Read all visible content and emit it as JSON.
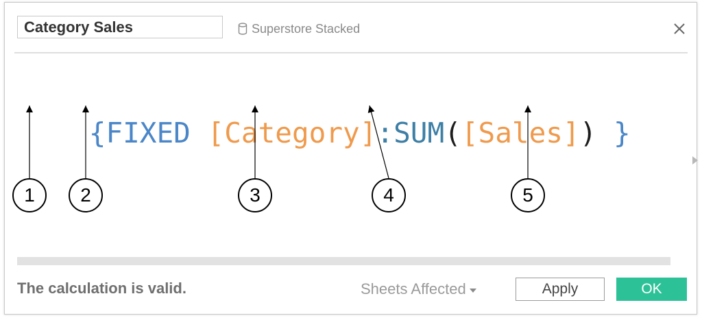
{
  "dialog": {
    "calc_name": "Category Sales",
    "data_source": "Superstore Stacked",
    "data_source_icon": "database-icon",
    "close_icon": "close-icon"
  },
  "formula": {
    "tokens": [
      {
        "text": "{",
        "color": "#4a86c8"
      },
      {
        "text": "FIXED",
        "color": "#4a86c8"
      },
      {
        "text": " ",
        "color": "#4a86c8"
      },
      {
        "text": "[Category]",
        "color": "#ef9a4c"
      },
      {
        "text": ":",
        "color": "#3e7fa6"
      },
      {
        "text": "SUM",
        "color": "#3e7fa6"
      },
      {
        "text": "(",
        "color": "#1e1e1e"
      },
      {
        "text": "[Sales]",
        "color": "#ef9a4c"
      },
      {
        "text": ")",
        "color": "#1e1e1e"
      },
      {
        "text": " ",
        "color": "#4a86c8"
      },
      {
        "text": "}",
        "color": "#4a86c8"
      }
    ]
  },
  "annotations": {
    "labels": [
      "1",
      "2",
      "3",
      "4",
      "5"
    ]
  },
  "footer": {
    "status": "The calculation is valid.",
    "sheets_affected": "Sheets Affected",
    "apply": "Apply",
    "ok": "OK"
  },
  "colors": {
    "accent_ok": "#2dc198",
    "field_orange": "#ef9a4c",
    "keyword_blue": "#4a86c8",
    "function_teal": "#3e7fa6"
  }
}
